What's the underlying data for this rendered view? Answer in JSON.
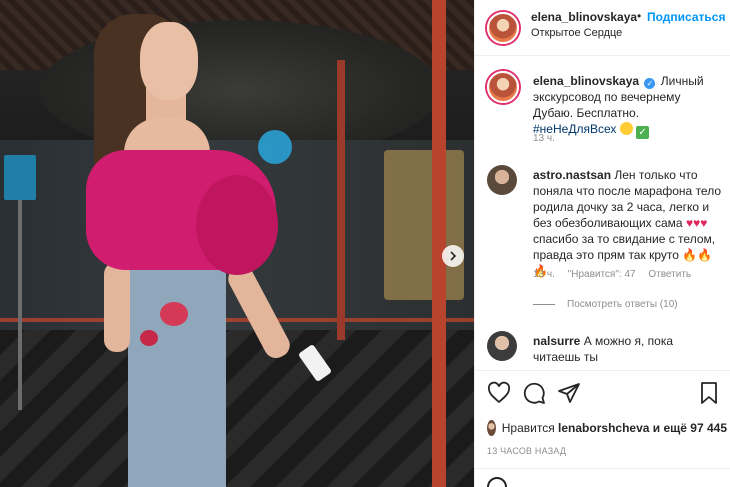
{
  "header": {
    "username": "elena_blinovskaya",
    "separator": "•",
    "follow_label": "Подписаться",
    "location": "Открытое Сердце"
  },
  "caption": {
    "username": "elena_blinovskaya",
    "verified_icon": "verified-badge-icon",
    "text": "Личный экскурсовод по вечернему Дубаю. Бесплатно.",
    "hashtag": "#неНеДляВсех",
    "time": "13 ч."
  },
  "comments": [
    {
      "username": "astro.nastsan",
      "text_1": "Лен только что поняла что после марафона тело родила дочку за 2 часа, легко и без обезболивающих сама",
      "text_2": "спасибо за то свидание с телом, правда это прям так круто",
      "time": "13 ч.",
      "likes": "\"Нравится\": 47",
      "reply_label": "Ответить",
      "view_replies": "Посмотреть ответы (10)"
    },
    {
      "username": "nalsurre",
      "text": "А можно я, пока читаешь ты"
    }
  ],
  "actions": {
    "like_icon": "heart-icon",
    "comment_icon": "comment-icon",
    "share_icon": "paper-plane-icon",
    "save_icon": "bookmark-icon"
  },
  "likes": {
    "prefix": "Нравится",
    "user": "lenaborshcheva",
    "suffix": "и ещё 97 445"
  },
  "time_ago": "13 ЧАСОВ НАЗАД",
  "colors": {
    "link_blue": "#0095f6",
    "hashtag": "#00376b",
    "muted": "#8e8e8e",
    "top_pink": "#d11d6f"
  }
}
